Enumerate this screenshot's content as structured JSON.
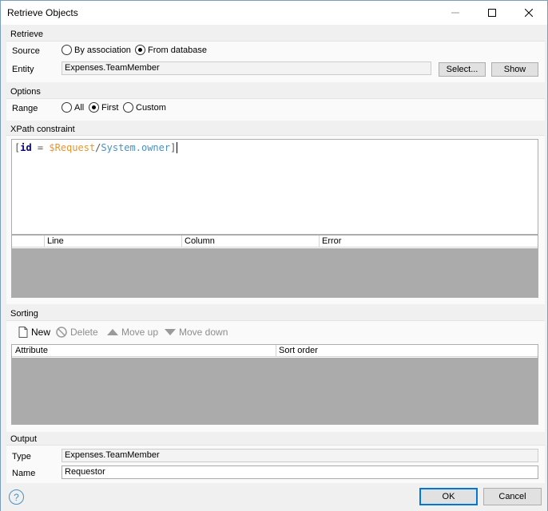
{
  "window": {
    "title": "Retrieve Objects"
  },
  "retrieve": {
    "section": "Retrieve",
    "source_label": "Source",
    "source_options": [
      "By association",
      "From database"
    ],
    "source_selected": "From database",
    "entity_label": "Entity",
    "entity_value": "Expenses.TeamMember",
    "select_button": "Select...",
    "show_button": "Show"
  },
  "options": {
    "section": "Options",
    "range_label": "Range",
    "range_options": [
      "All",
      "First",
      "Custom"
    ],
    "range_selected": "First"
  },
  "xpath": {
    "section": "XPath constraint",
    "tokens": [
      "[",
      "id",
      " = ",
      "$Request",
      "/",
      "System.owner",
      "]"
    ],
    "errors_columns": [
      "Line",
      "Column",
      "Error"
    ]
  },
  "sorting": {
    "section": "Sorting",
    "toolbar": {
      "new": "New",
      "delete": "Delete",
      "move_up": "Move up",
      "move_down": "Move down"
    },
    "columns": [
      "Attribute",
      "Sort order"
    ]
  },
  "output": {
    "section": "Output",
    "type_label": "Type",
    "type_value": "Expenses.TeamMember",
    "name_label": "Name",
    "name_value": "Requestor"
  },
  "footer": {
    "help": "?",
    "ok": "OK",
    "cancel": "Cancel"
  }
}
